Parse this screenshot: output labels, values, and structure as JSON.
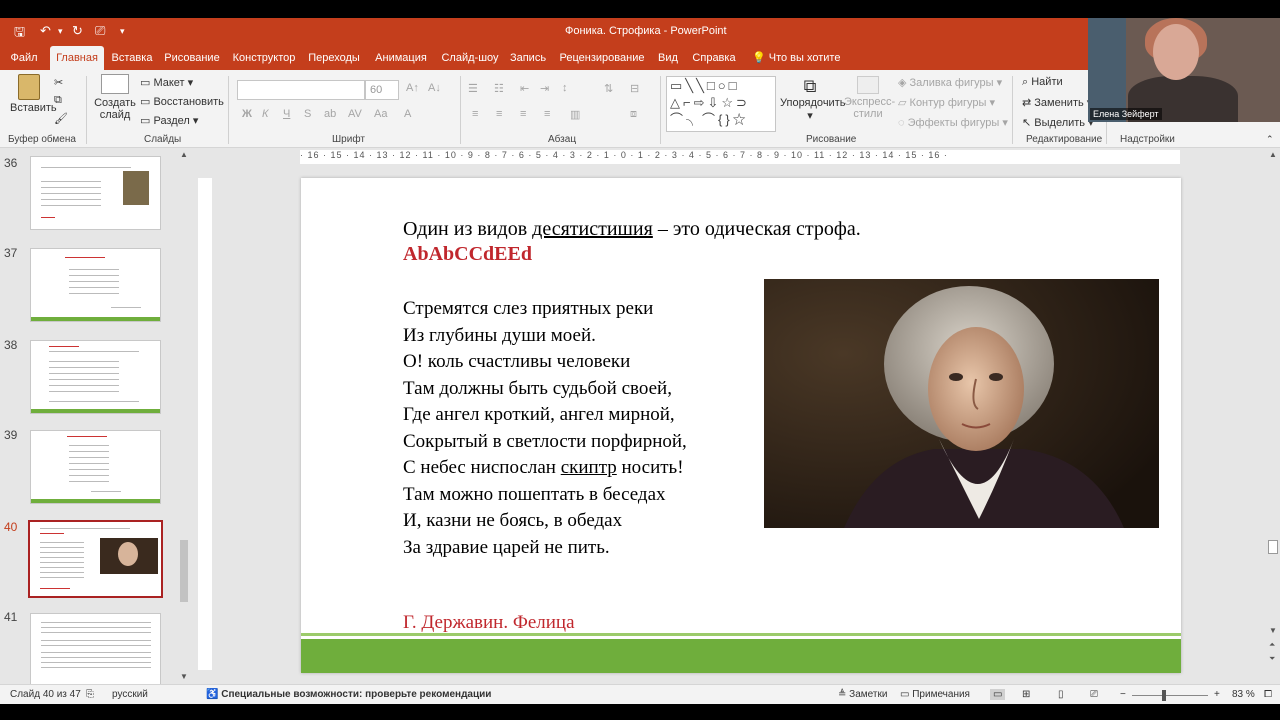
{
  "window": {
    "title": "Фоника. Строфика  -  PowerPoint"
  },
  "quick_access": {
    "save_icon": "save-icon",
    "undo_icon": "undo-icon",
    "redo_icon": "redo-icon"
  },
  "tabs": [
    "Файл",
    "Главная",
    "Вставка",
    "Рисование",
    "Конструктор",
    "Переходы",
    "Анимация",
    "Слайд-шоу",
    "Запись",
    "Рецензирование",
    "Вид",
    "Справка"
  ],
  "active_tab": "Главная",
  "tell_me": "Что вы хотите сделать?",
  "ribbon": {
    "paste": "Вставить",
    "new_slide": "Создать слайд",
    "layout": "Макет",
    "reset": "Восстановить",
    "section": "Раздел",
    "font_size": "60",
    "bold": "Ж",
    "italic": "К",
    "underline": "Ч",
    "strike": "S",
    "arrange": "Упорядочить",
    "quick_styles": "Экспресс-стили",
    "fill": "Заливка фигуры",
    "outline": "Контур фигуры",
    "effects": "Эффекты фигуры",
    "find": "Найти",
    "replace": "Заменить",
    "select": "Выделить",
    "groups": {
      "clipboard": "Буфер обмена",
      "slides": "Слайды",
      "font": "Шрифт",
      "paragraph": "Абзац",
      "drawing": "Рисование",
      "editing": "Редактирование",
      "addins": "Надстройки"
    }
  },
  "video": {
    "name": "Елена Зейферт"
  },
  "thumbnails": [
    {
      "num": "36",
      "selected": false
    },
    {
      "num": "37",
      "selected": false
    },
    {
      "num": "38",
      "selected": false
    },
    {
      "num": "39",
      "selected": false
    },
    {
      "num": "40",
      "selected": true
    },
    {
      "num": "41",
      "selected": false
    }
  ],
  "ruler_text": "· 16 · 15 · 14 · 13 · 12 · 11 · 10 · 9 · 8 · 7 · 6 · 5 · 4 · 3 · 2 · 1 · 0 · 1 · 2 · 3 · 4 · 5 · 6 · 7 · 8 · 9 · 10 · 11 · 12 · 13 · 14 · 15 · 16 ·",
  "slide": {
    "line1_a": "Один из видов ",
    "line1_u": "десятистишия",
    "line1_b": " – это одическая  строфа.",
    "scheme": "AbAbCCdEEd",
    "poem": [
      "Стремятся слез приятных реки",
      "Из глубины души моей.",
      "О! коль счастливы человеки",
      "Там должны быть судьбой своей,",
      "Где ангел кроткий, ангел мирной,",
      "Сокрытый в светлости порфирной,",
      "С небес ниспослан ",
      "Там можно пошептать в беседах",
      "И, казни не боясь, в обедах",
      "За здравие царей не пить."
    ],
    "poem_line7_u": "скиптр",
    "poem_line7_end": " носить!",
    "author": "Г. Державин. Фелица"
  },
  "status": {
    "slide_count": "Слайд 40 из 47",
    "language": "русский",
    "accessibility": "Специальные возможности: проверьте рекомендации",
    "notes": "Заметки",
    "comments": "Примечания",
    "zoom": "83 %"
  },
  "colors": {
    "accent": "#c43e1c",
    "green_band": "#6fae3c",
    "red_text": "#c0272d"
  }
}
